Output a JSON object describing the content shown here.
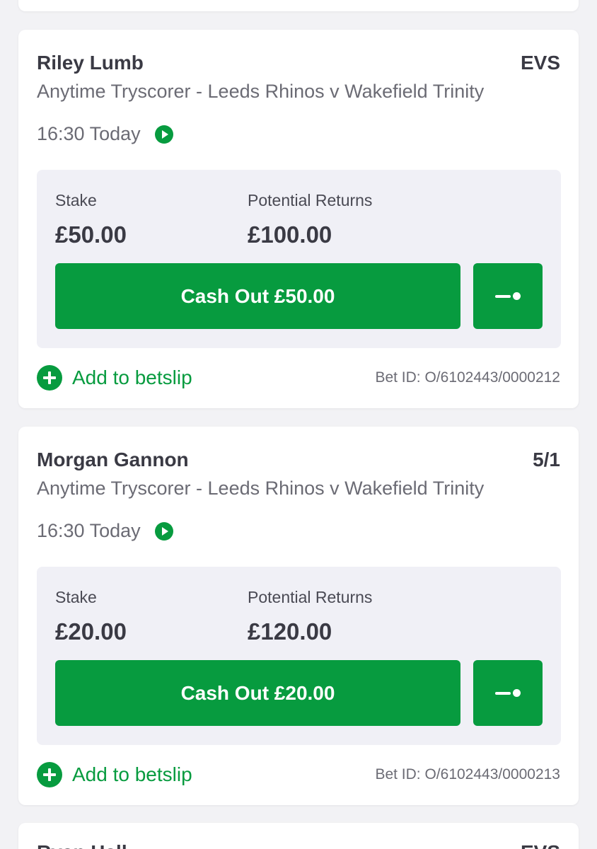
{
  "bets": [
    {
      "selection": "Riley Lumb",
      "odds": "EVS",
      "market": "Anytime Tryscorer - Leeds Rhinos v Wakefield Trinity",
      "time": "16:30 Today",
      "stake_label": "Stake",
      "stake_value": "£50.00",
      "returns_label": "Potential Returns",
      "returns_value": "£100.00",
      "cashout_label": "Cash Out £50.00",
      "add_label": "Add to betslip",
      "bet_id": "Bet ID: O/6102443/0000212"
    },
    {
      "selection": "Morgan Gannon",
      "odds": "5/1",
      "market": "Anytime Tryscorer - Leeds Rhinos v Wakefield Trinity",
      "time": "16:30 Today",
      "stake_label": "Stake",
      "stake_value": "£20.00",
      "returns_label": "Potential Returns",
      "returns_value": "£120.00",
      "cashout_label": "Cash Out £20.00",
      "add_label": "Add to betslip",
      "bet_id": "Bet ID: O/6102443/0000213"
    }
  ],
  "next_bet": {
    "selection": "Ryan Hall",
    "odds": "EVS"
  },
  "colors": {
    "accent": "#079b3f",
    "background": "#f2f2f5",
    "panel": "#f0f0f6",
    "text": "#3a3a44",
    "muted": "#6b6b74"
  },
  "icons": {
    "live": "play-circle-icon",
    "partial_cashout": "slider-icon",
    "add": "plus-circle-icon"
  }
}
